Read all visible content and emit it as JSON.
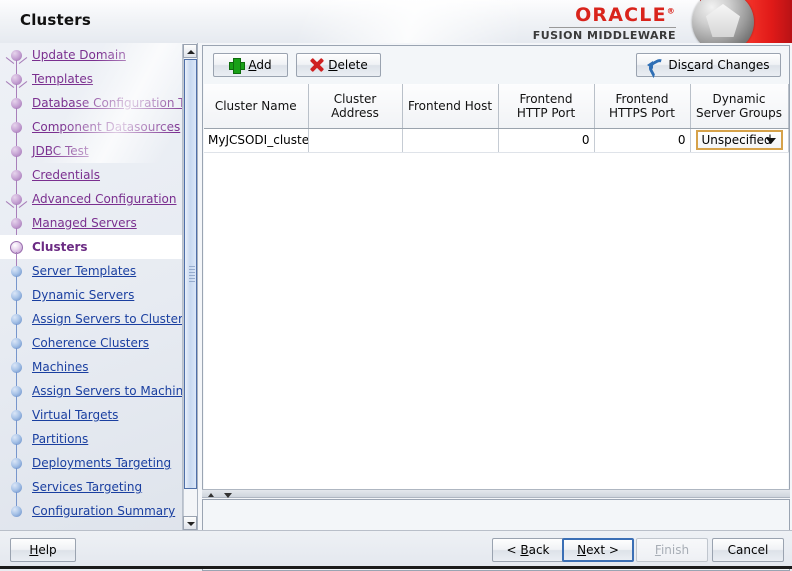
{
  "window": {
    "page_title": "Clusters"
  },
  "brand": {
    "oracle": "ORACLE",
    "registered": "®",
    "product": "FUSION MIDDLEWARE",
    "red": "#ee2a22"
  },
  "sidebar": {
    "items": [
      {
        "label": "Update Domain",
        "state": "done",
        "branch": true
      },
      {
        "label": "Templates",
        "state": "done",
        "branch": true
      },
      {
        "label": "Database Configuration Type",
        "state": "done",
        "branch": false
      },
      {
        "label": "Component Datasources",
        "state": "done",
        "branch": false
      },
      {
        "label": "JDBC Test",
        "state": "done",
        "branch": false
      },
      {
        "label": "Credentials",
        "state": "done",
        "branch": false
      },
      {
        "label": "Advanced Configuration",
        "state": "done",
        "branch": true
      },
      {
        "label": "Managed Servers",
        "state": "done",
        "branch": false
      },
      {
        "label": "Clusters",
        "state": "current",
        "branch": false
      },
      {
        "label": "Server Templates",
        "state": "todo",
        "branch": false
      },
      {
        "label": "Dynamic Servers",
        "state": "todo",
        "branch": false
      },
      {
        "label": "Assign Servers to Clusters",
        "state": "todo",
        "branch": false
      },
      {
        "label": "Coherence Clusters",
        "state": "todo",
        "branch": false
      },
      {
        "label": "Machines",
        "state": "todo",
        "branch": false
      },
      {
        "label": "Assign Servers to Machines",
        "state": "todo",
        "branch": false
      },
      {
        "label": "Virtual Targets",
        "state": "todo",
        "branch": false
      },
      {
        "label": "Partitions",
        "state": "todo",
        "branch": false
      },
      {
        "label": "Deployments Targeting",
        "state": "todo",
        "branch": false
      },
      {
        "label": "Services Targeting",
        "state": "todo",
        "branch": false
      },
      {
        "label": "Configuration Summary",
        "state": "todo",
        "branch": false
      }
    ],
    "colors": {
      "done": "#7a2f8f",
      "todo": "#1a3fa0",
      "current": "#6b2b83"
    }
  },
  "toolbar": {
    "add_label": "Add",
    "add_mnemonic": "A",
    "delete_label": "Delete",
    "delete_mnemonic": "D",
    "discard_label_pre": "Dis",
    "discard_mnemonic": "c",
    "discard_label_post": "ard Changes",
    "icons": {
      "add": "plus-icon",
      "delete": "x-icon",
      "discard": "undo-icon"
    }
  },
  "table": {
    "columns": [
      "Cluster Name",
      "Cluster Address",
      "Frontend Host",
      "Frontend HTTP Port",
      "Frontend HTTPS Port",
      "Dynamic Server Groups"
    ],
    "rows": [
      {
        "cluster_name": "MyJCSODI_cluste",
        "cluster_address": "",
        "frontend_host": "",
        "frontend_http_port": "0",
        "frontend_https_port": "0",
        "dynamic_server_groups": "Unspecified"
      }
    ]
  },
  "footer": {
    "help": "Help",
    "back": "< Back",
    "back_mnemonic": "B",
    "next": "Next >",
    "next_mnemonic": "N",
    "finish": "Finish",
    "finish_mnemonic": "F",
    "cancel": "Cancel"
  }
}
